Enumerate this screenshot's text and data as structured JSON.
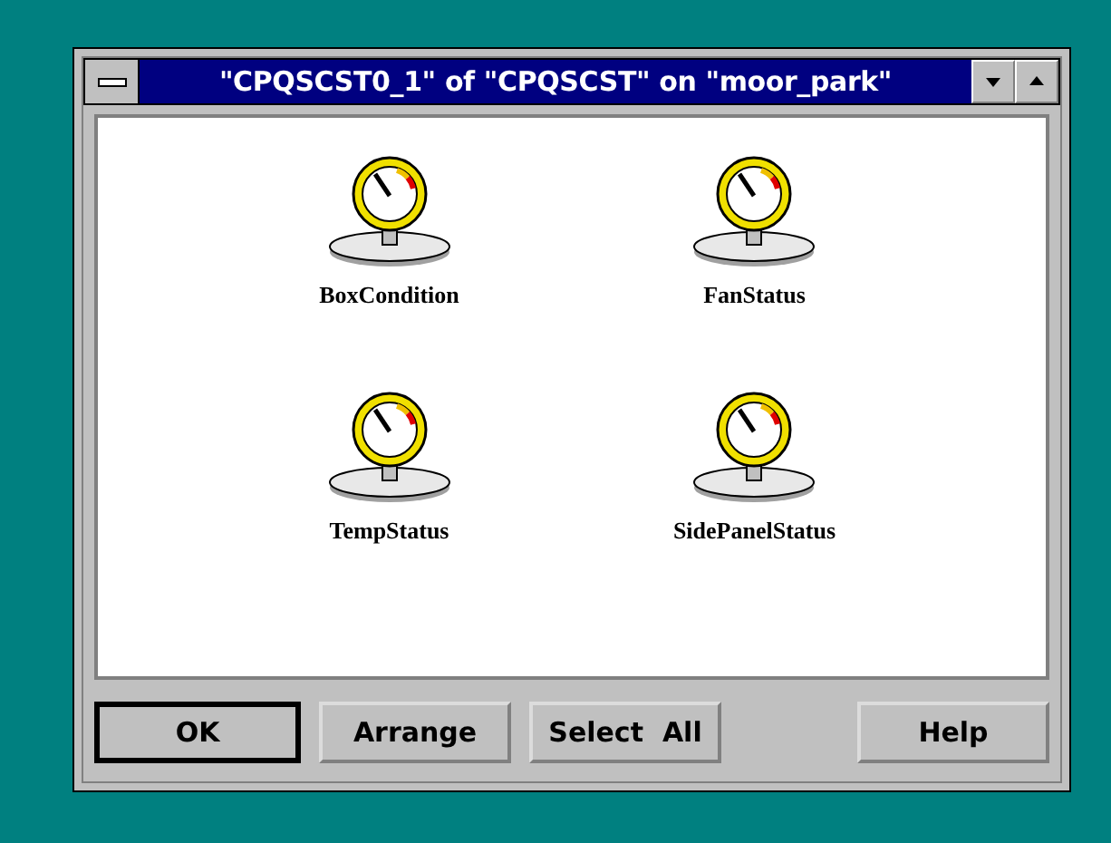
{
  "window": {
    "title": "\"CPQSCST0_1\" of \"CPQSCST\" on \"moor_park\""
  },
  "objects": [
    {
      "label": "BoxCondition"
    },
    {
      "label": "FanStatus"
    },
    {
      "label": "TempStatus"
    },
    {
      "label": "SidePanelStatus"
    }
  ],
  "buttons": [
    {
      "label": "OK",
      "default": true
    },
    {
      "label": "Arrange",
      "default": false
    },
    {
      "label": "Select  All",
      "default": false
    },
    {
      "label": "Help",
      "default": false
    }
  ]
}
